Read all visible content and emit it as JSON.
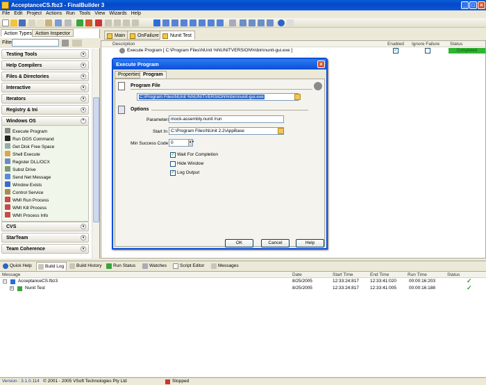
{
  "window": {
    "title": "AcceptanceCS.fbz3 - FinalBuilder 3"
  },
  "menu": [
    "File",
    "Edit",
    "Project",
    "Actions",
    "Run",
    "Tools",
    "View",
    "Wizards",
    "Help"
  ],
  "left_panel": {
    "tabs": [
      "Action Types",
      "Action Inspector"
    ],
    "filter_label": "Filter",
    "categories_top": [
      "Testing Tools",
      "Help Compilers",
      "Files & Directories",
      "Interactive",
      "Iterators",
      "Registry & Ini",
      "Windows OS"
    ],
    "windows_os_items": [
      "Execute Program",
      "Run DOS Command",
      "Get Disk Free Space",
      "Shell Execute",
      "Register DLL/OCX",
      "Subst Drive",
      "Send Net Message",
      "Window Exists",
      "Control Service",
      "WMI Run Process",
      "WMI Kill Process",
      "WMI Process Info"
    ],
    "categories_bottom": [
      "CVS",
      "StarTeam",
      "Team Coherence"
    ]
  },
  "doc_tabs": [
    "Main",
    "OnFailure",
    "Nunit Test"
  ],
  "action_list": {
    "headers": {
      "description": "Description",
      "enabled": "Enabled",
      "ignore_failure": "Ignore Failure",
      "status": "Status"
    },
    "row": {
      "description": "Execute Program [ C:\\Program Files\\NUnit %NUNITVERSION%\\bin\\nunit-gui.exe ]",
      "status": "Completed"
    }
  },
  "dialog": {
    "title": "Execute Program",
    "tabs": [
      "Properties",
      "Program"
    ],
    "program_file_heading": "Program File",
    "program_file_value": "C:\\Program Files\\NUnit %NUNITVERSION%\\bin\\nunit-gui.exe",
    "options_heading": "Options",
    "parameters_label": "Parameters :",
    "parameters_value": "mock-assembly.nunit /run",
    "start_in_label": "Start In :",
    "start_in_value": "C:\\Program Files\\NUnit 2.2\\AppBase",
    "min_success_label": "Min Success Code :",
    "min_success_value": "0",
    "checkboxes": [
      {
        "label": "Wait For Completion",
        "checked": true
      },
      {
        "label": "Hide Window",
        "checked": false
      },
      {
        "label": "Log Output",
        "checked": true
      }
    ],
    "buttons": {
      "ok": "OK",
      "cancel": "Cancel",
      "help": "Help"
    }
  },
  "bottom_tabs": [
    "Quick Help",
    "Build Log",
    "Build History",
    "Run Status",
    "Watches",
    "Script Editor",
    "Messages"
  ],
  "build_log": {
    "headers": {
      "message": "Message",
      "date": "Date",
      "start": "Start Time",
      "end": "End Time",
      "run": "Run Time",
      "status": "Status"
    },
    "rows": [
      {
        "message": "AcceptanceCS.fbz3",
        "date": "8/25/2005",
        "start": "12:33:24:817",
        "end": "12:33:41:020",
        "run": "00:00:16:203"
      },
      {
        "message": "Nunit Test",
        "date": "8/25/2005",
        "start": "12:33:24:817",
        "end": "12:33:41:005",
        "run": "00:00:16:188"
      }
    ]
  },
  "status_bar": {
    "version": "Version : 3.1.0.114",
    "copyright": "© 2001 - 2005 VSoft Technologies Pty Ltd",
    "state": "Stopped"
  }
}
